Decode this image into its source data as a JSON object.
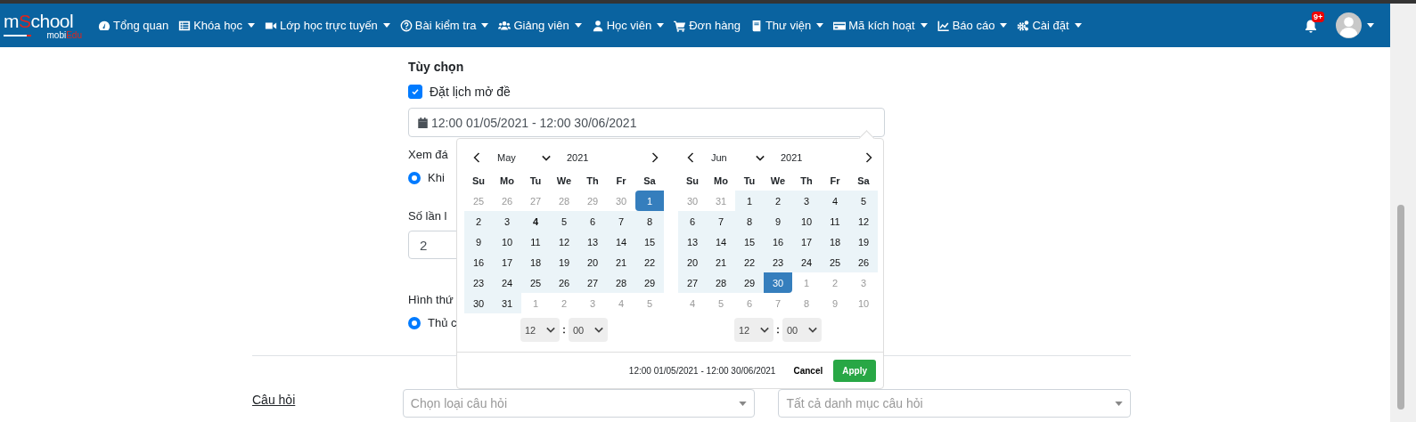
{
  "navbar": {
    "logo": {
      "top": [
        {
          "text": "m",
          "accent": false
        },
        {
          "text": "S",
          "accent": true
        },
        {
          "text": "chool",
          "accent": false
        }
      ],
      "bottom": [
        {
          "text": "mobi",
          "accent": false
        },
        {
          "text": "Edu",
          "accent": true
        }
      ]
    },
    "items": [
      {
        "label": "Tổng quan",
        "dropdown": false
      },
      {
        "label": "Khóa học",
        "dropdown": true
      },
      {
        "label": "Lớp học trực tuyến",
        "dropdown": true
      },
      {
        "label": "Bài kiểm tra",
        "dropdown": true
      },
      {
        "label": "Giảng viên",
        "dropdown": true
      },
      {
        "label": "Học viên",
        "dropdown": true
      },
      {
        "label": "Đơn hàng",
        "dropdown": false
      },
      {
        "label": "Thư viện",
        "dropdown": true
      },
      {
        "label": "Mã kích hoạt",
        "dropdown": true
      },
      {
        "label": "Báo cáo",
        "dropdown": true
      },
      {
        "label": "Cài đặt",
        "dropdown": true
      }
    ],
    "notification_badge": "9+"
  },
  "form": {
    "section_title": "Tùy chọn",
    "schedule": {
      "label": "Đặt lịch mở đề",
      "checked": true,
      "value": "12:00 01/05/2021 - 12:00 30/06/2021"
    },
    "answers_label": "Xem đá",
    "answers_option": {
      "label": "Khi",
      "selected": true
    },
    "attempts_label": "Số lần l",
    "attempts_value": "2",
    "mode_label": "Hình thứ",
    "mode_option": {
      "label": "Thủ c",
      "selected": true
    },
    "questions_link": "Câu hỏi",
    "question_type": {
      "placeholder": "Chọn loại câu hỏi"
    },
    "question_category": {
      "placeholder": "Tất cả danh mục câu hỏi"
    }
  },
  "datepicker": {
    "calendars": [
      {
        "month": "May",
        "year": "2021",
        "weekdays": [
          "Su",
          "Mo",
          "Tu",
          "We",
          "Th",
          "Fr",
          "Sa"
        ],
        "hour": "12",
        "minute": "00",
        "weeks": [
          [
            {
              "d": "25",
              "kind": "off"
            },
            {
              "d": "26",
              "kind": "off"
            },
            {
              "d": "27",
              "kind": "off"
            },
            {
              "d": "28",
              "kind": "off"
            },
            {
              "d": "29",
              "kind": "off"
            },
            {
              "d": "30",
              "kind": "off"
            },
            {
              "d": "1",
              "kind": "start"
            }
          ],
          [
            {
              "d": "2",
              "kind": "range"
            },
            {
              "d": "3",
              "kind": "range"
            },
            {
              "d": "4",
              "kind": "range",
              "today": true
            },
            {
              "d": "5",
              "kind": "range"
            },
            {
              "d": "6",
              "kind": "range"
            },
            {
              "d": "7",
              "kind": "range"
            },
            {
              "d": "8",
              "kind": "range"
            }
          ],
          [
            {
              "d": "9",
              "kind": "range"
            },
            {
              "d": "10",
              "kind": "range"
            },
            {
              "d": "11",
              "kind": "range"
            },
            {
              "d": "12",
              "kind": "range"
            },
            {
              "d": "13",
              "kind": "range"
            },
            {
              "d": "14",
              "kind": "range"
            },
            {
              "d": "15",
              "kind": "range"
            }
          ],
          [
            {
              "d": "16",
              "kind": "range"
            },
            {
              "d": "17",
              "kind": "range"
            },
            {
              "d": "18",
              "kind": "range"
            },
            {
              "d": "19",
              "kind": "range"
            },
            {
              "d": "20",
              "kind": "range"
            },
            {
              "d": "21",
              "kind": "range"
            },
            {
              "d": "22",
              "kind": "range"
            }
          ],
          [
            {
              "d": "23",
              "kind": "range"
            },
            {
              "d": "24",
              "kind": "range"
            },
            {
              "d": "25",
              "kind": "range"
            },
            {
              "d": "26",
              "kind": "range"
            },
            {
              "d": "27",
              "kind": "range"
            },
            {
              "d": "28",
              "kind": "range"
            },
            {
              "d": "29",
              "kind": "range"
            }
          ],
          [
            {
              "d": "30",
              "kind": "range"
            },
            {
              "d": "31",
              "kind": "range"
            },
            {
              "d": "1",
              "kind": "off"
            },
            {
              "d": "2",
              "kind": "off"
            },
            {
              "d": "3",
              "kind": "off"
            },
            {
              "d": "4",
              "kind": "off"
            },
            {
              "d": "5",
              "kind": "off"
            }
          ]
        ]
      },
      {
        "month": "Jun",
        "year": "2021",
        "weekdays": [
          "Su",
          "Mo",
          "Tu",
          "We",
          "Th",
          "Fr",
          "Sa"
        ],
        "hour": "12",
        "minute": "00",
        "weeks": [
          [
            {
              "d": "30",
              "kind": "off"
            },
            {
              "d": "31",
              "kind": "off"
            },
            {
              "d": "1",
              "kind": "range"
            },
            {
              "d": "2",
              "kind": "range"
            },
            {
              "d": "3",
              "kind": "range"
            },
            {
              "d": "4",
              "kind": "range"
            },
            {
              "d": "5",
              "kind": "range"
            }
          ],
          [
            {
              "d": "6",
              "kind": "range"
            },
            {
              "d": "7",
              "kind": "range"
            },
            {
              "d": "8",
              "kind": "range"
            },
            {
              "d": "9",
              "kind": "range"
            },
            {
              "d": "10",
              "kind": "range"
            },
            {
              "d": "11",
              "kind": "range"
            },
            {
              "d": "12",
              "kind": "range"
            }
          ],
          [
            {
              "d": "13",
              "kind": "range"
            },
            {
              "d": "14",
              "kind": "range"
            },
            {
              "d": "15",
              "kind": "range"
            },
            {
              "d": "16",
              "kind": "range"
            },
            {
              "d": "17",
              "kind": "range"
            },
            {
              "d": "18",
              "kind": "range"
            },
            {
              "d": "19",
              "kind": "range"
            }
          ],
          [
            {
              "d": "20",
              "kind": "range"
            },
            {
              "d": "21",
              "kind": "range"
            },
            {
              "d": "22",
              "kind": "range"
            },
            {
              "d": "23",
              "kind": "range"
            },
            {
              "d": "24",
              "kind": "range"
            },
            {
              "d": "25",
              "kind": "range"
            },
            {
              "d": "26",
              "kind": "range"
            }
          ],
          [
            {
              "d": "27",
              "kind": "range"
            },
            {
              "d": "28",
              "kind": "range"
            },
            {
              "d": "29",
              "kind": "range"
            },
            {
              "d": "30",
              "kind": "end"
            },
            {
              "d": "1",
              "kind": "off"
            },
            {
              "d": "2",
              "kind": "off"
            },
            {
              "d": "3",
              "kind": "off"
            }
          ],
          [
            {
              "d": "4",
              "kind": "off"
            },
            {
              "d": "5",
              "kind": "off"
            },
            {
              "d": "6",
              "kind": "off"
            },
            {
              "d": "7",
              "kind": "off"
            },
            {
              "d": "8",
              "kind": "off"
            },
            {
              "d": "9",
              "kind": "off"
            },
            {
              "d": "10",
              "kind": "off"
            }
          ]
        ]
      }
    ],
    "selected_range": "12:00 01/05/2021 - 12:00 30/06/2021",
    "cancel": "Cancel",
    "apply": "Apply"
  }
}
